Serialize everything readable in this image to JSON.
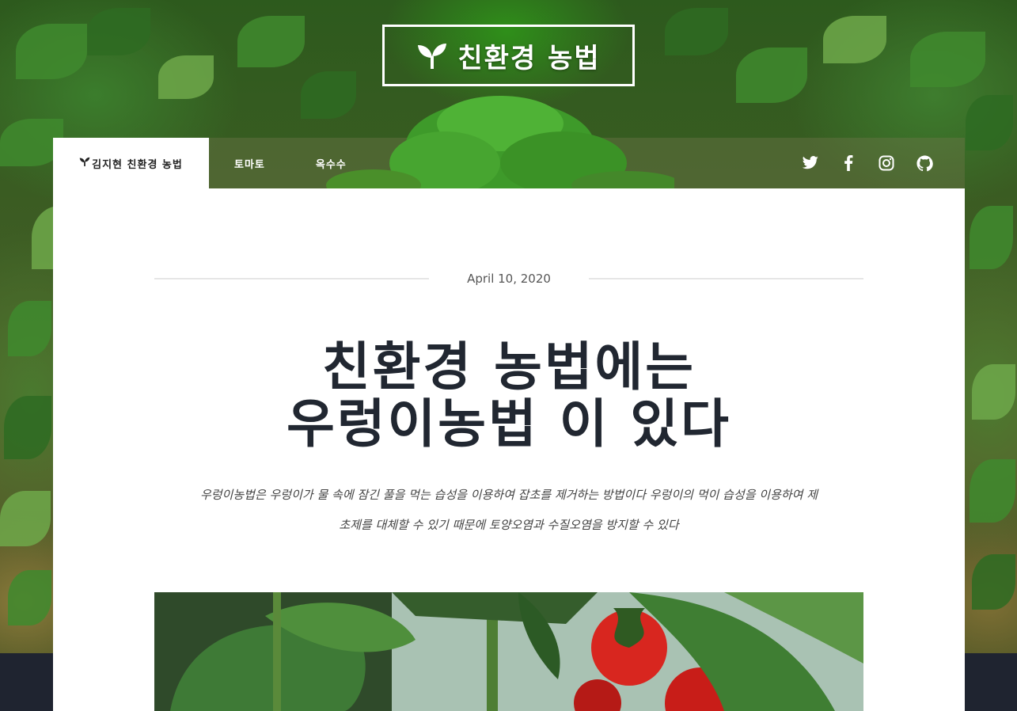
{
  "site": {
    "logo_text": "친환경 농법"
  },
  "nav": {
    "items": [
      {
        "label": "김지현 친환경 농법",
        "active": true
      },
      {
        "label": "토마토",
        "active": false
      },
      {
        "label": "옥수수",
        "active": false
      }
    ],
    "social": [
      "twitter-icon",
      "facebook-icon",
      "instagram-icon",
      "github-icon"
    ]
  },
  "post": {
    "date": "April 10, 2020",
    "title_line1": "친환경 농법에는",
    "title_line2": "우렁이농법 이 있다",
    "subtitle_line1": "우렁이농법은 우렁이가 물 속에 잠긴 풀을 먹는 습성을 이용하여 잡초를 제거하는 방법이다 우렁이의 먹이 습성을 이용하여 제",
    "subtitle_line2": "초제를 대체할 수 있기 때문에 토양오염과 수질오염을 방지할 수 있다"
  },
  "colors": {
    "footer": "#1f2430",
    "title": "#212731",
    "tomato": "#d8261f",
    "leaf": "#3f8a2e"
  }
}
